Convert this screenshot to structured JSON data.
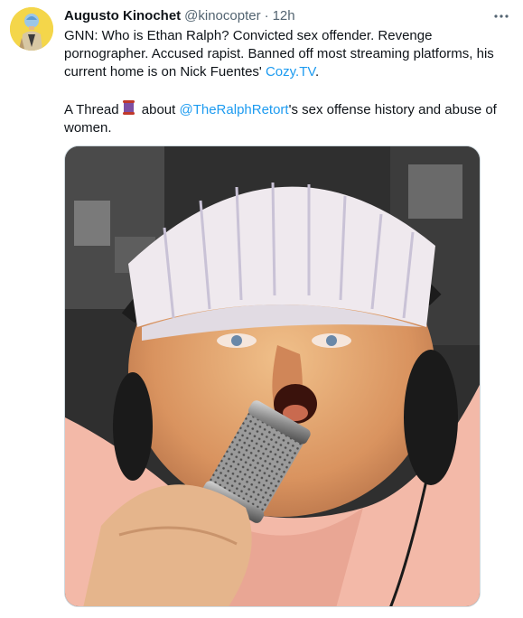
{
  "author": {
    "display_name": "Augusto Kinochet",
    "handle": "@kinocopter",
    "separator": "·",
    "timestamp": "12h",
    "avatar_icon": "avatar"
  },
  "tweet": {
    "paragraph1": {
      "text_a": "GNN: Who is Ethan Ralph? Convicted sex offender. Revenge pornographer. Accused rapist. Banned off most streaming platforms, his current home is on Nick Fuentes' ",
      "link": "Cozy.TV",
      "text_b": "."
    },
    "paragraph2": {
      "text_a": "A Thread",
      "emoji_icon": "scroll-icon",
      "text_b": " about ",
      "mention": "@TheRalphRetort",
      "text_c": "'s sex offense history and abuse of women."
    }
  },
  "media": {
    "description_icon": "photo"
  },
  "colors": {
    "link": "#1d9bf0",
    "secondary_text": "#536471",
    "primary_text": "#0f1419",
    "media_border": "#cfd9de"
  }
}
